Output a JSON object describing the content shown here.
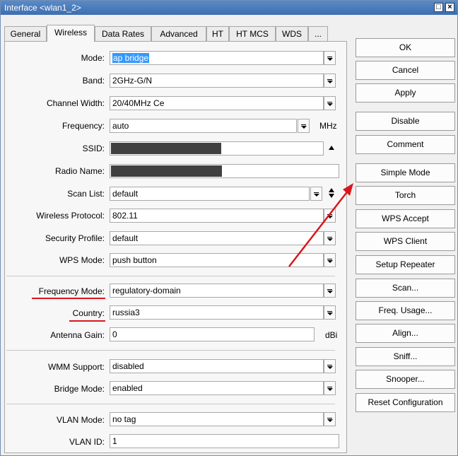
{
  "window": {
    "title": "Interface <wlan1_2>"
  },
  "tabs": [
    {
      "label": "General"
    },
    {
      "label": "Wireless"
    },
    {
      "label": "Data Rates"
    },
    {
      "label": "Advanced"
    },
    {
      "label": "HT"
    },
    {
      "label": "HT MCS"
    },
    {
      "label": "WDS"
    },
    {
      "label": "..."
    }
  ],
  "form": {
    "mode": {
      "label": "Mode:",
      "value": "ap bridge"
    },
    "band": {
      "label": "Band:",
      "value": "2GHz-G/N"
    },
    "channel_width": {
      "label": "Channel Width:",
      "value": "20/40MHz Ce"
    },
    "frequency": {
      "label": "Frequency:",
      "value": "auto",
      "unit": "MHz"
    },
    "ssid": {
      "label": "SSID:"
    },
    "radio_name": {
      "label": "Radio Name:"
    },
    "scan_list": {
      "label": "Scan List:",
      "value": "default"
    },
    "wireless_protocol": {
      "label": "Wireless Protocol:",
      "value": "802.11"
    },
    "security_profile": {
      "label": "Security Profile:",
      "value": "default"
    },
    "wps_mode": {
      "label": "WPS Mode:",
      "value": "push button"
    },
    "frequency_mode": {
      "label": "Frequency Mode:",
      "value": "regulatory-domain"
    },
    "country": {
      "label": "Country:",
      "value": "russia3"
    },
    "antenna_gain": {
      "label": "Antenna Gain:",
      "value": "0",
      "unit": "dBi"
    },
    "wmm_support": {
      "label": "WMM Support:",
      "value": "disabled"
    },
    "bridge_mode": {
      "label": "Bridge Mode:",
      "value": "enabled"
    },
    "vlan_mode": {
      "label": "VLAN Mode:",
      "value": "no tag"
    },
    "vlan_id": {
      "label": "VLAN ID:",
      "value": "1"
    }
  },
  "buttons": {
    "ok": "OK",
    "cancel": "Cancel",
    "apply": "Apply",
    "disable": "Disable",
    "comment": "Comment",
    "simple_mode": "Simple Mode",
    "torch": "Torch",
    "wps_accept": "WPS Accept",
    "wps_client": "WPS Client",
    "setup_repeater": "Setup Repeater",
    "scan": "Scan...",
    "freq_usage": "Freq. Usage...",
    "align": "Align...",
    "sniff": "Sniff...",
    "snooper": "Snooper...",
    "reset_configuration": "Reset Configuration"
  },
  "colors": {
    "title_bar": "#3d6eb0",
    "highlight": "#3399ff",
    "annotation_red": "#d8171c"
  },
  "icons": {
    "minimize": "restore-icon",
    "close": "close-icon",
    "dropdown": "dropdown-icon",
    "collapse": "collapse-icon",
    "updown": "updown-icon"
  }
}
